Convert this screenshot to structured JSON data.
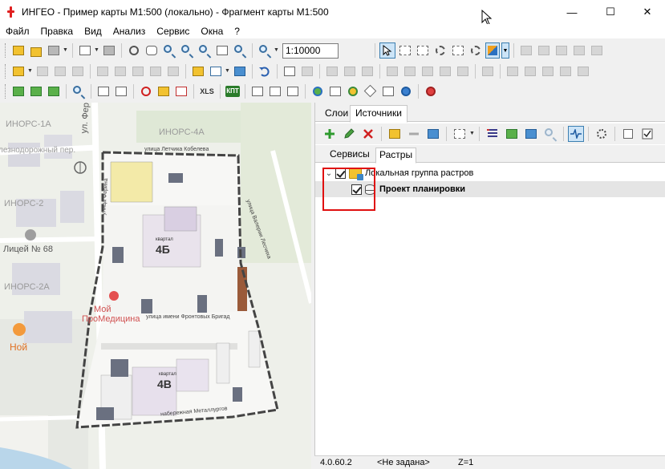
{
  "window": {
    "title": "ИНГЕО - Пример карты M1:500 (локально) - Фрагмент карты M1:500",
    "minimize": "—",
    "maximize": "☐",
    "close": "✕"
  },
  "menu": [
    "Файл",
    "Правка",
    "Вид",
    "Анализ",
    "Сервис",
    "Окна",
    "?"
  ],
  "toolbar": {
    "scale_value": "1:10000",
    "xls_label": "XLS",
    "kpt_label": "КПТ"
  },
  "map": {
    "labels": {
      "inors1a": "ИНОРС-1А",
      "inors4a": "ИНОРС-4А",
      "inors2": "ИНОРС-2",
      "inors2a": "ИНОРС-2А",
      "railway": "лезнодорожный пер.",
      "ferina": "ул. Ферина",
      "lyceum": "Лицей № 68",
      "mediсina": "ПроМедицина",
      "moy": "Мой",
      "noy": "Ной",
      "kvartal4b_word": "квартал",
      "kvartal4b": "4Б",
      "kvartal4v_word": "квартал",
      "kvartal4v": "4В",
      "street_top": "улица Летчика Кобелева",
      "street_mid": "улица имени Фронтовых Бригад",
      "street_bottom": "набережная Металлургов",
      "street_right": "улица Валерии Лесчиха",
      "street_ferina": "улица Ферина"
    }
  },
  "panel": {
    "tabs": {
      "layers": "Слои",
      "sources": "Источники"
    },
    "subtabs": {
      "services": "Сервисы",
      "rasters": "Растры"
    },
    "tree": {
      "group_label": "Локальная группа растров",
      "item_label": "Проект планировки"
    }
  },
  "status": {
    "version": "4.0.60.2",
    "not_set": "<Не задана>",
    "z": "Z=1"
  }
}
